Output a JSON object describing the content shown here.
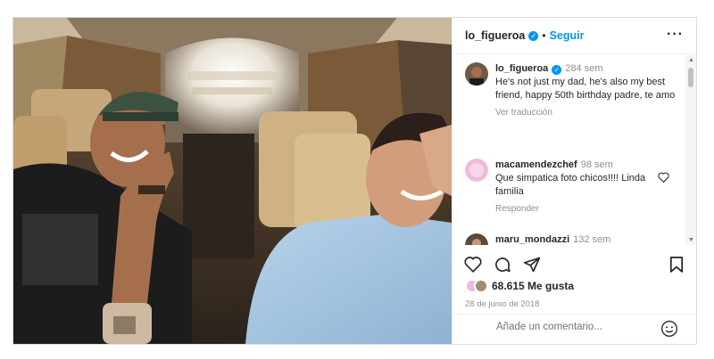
{
  "post": {
    "username": "lo_figueroa",
    "separator": "•",
    "follow_label": "Seguir",
    "more_label": "···",
    "photo_alt": "",
    "caption": {
      "username": "lo_figueroa",
      "time": "284 sem",
      "text": "He's not just my dad, he's also my best friend, happy 50th birthday padre, te amo",
      "translate_label": "Ver traducción"
    },
    "comments": [
      {
        "username": "macamendezchef",
        "time": "98 sem",
        "text": "Que simpatica foto chicos!!!! Linda familia",
        "reply_label": "Responder"
      },
      {
        "username": "maru_mondazzi",
        "time": "132 sem",
        "text": ""
      }
    ],
    "likes": "68.615 Me gusta",
    "date": "28 de junio de 2018",
    "comment_placeholder": "Añade un comentario..."
  },
  "colors": {
    "accent": "#0095f6",
    "verified": "#0095f6",
    "muted": "#8e8e8e",
    "border": "#dbdbdb"
  },
  "icons": [
    "verified-icon",
    "more-options-icon",
    "heart-icon",
    "comment-icon",
    "share-icon",
    "bookmark-icon",
    "emoji-icon",
    "scroll-up-icon",
    "scroll-down-icon"
  ]
}
